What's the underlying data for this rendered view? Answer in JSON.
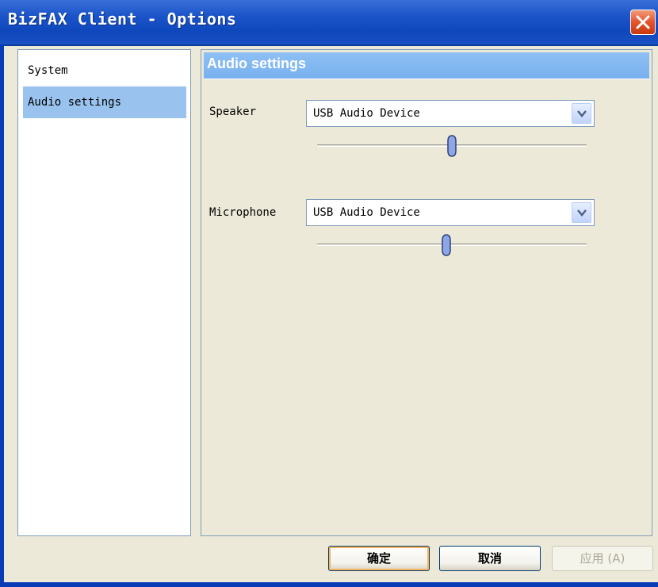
{
  "window": {
    "title": "BizFAX Client - Options"
  },
  "sidebar": {
    "items": [
      {
        "label": "System",
        "selected": false
      },
      {
        "label": "Audio settings",
        "selected": true
      }
    ]
  },
  "panel": {
    "header": "Audio settings",
    "speaker": {
      "label": "Speaker",
      "device": "USB Audio Device",
      "volume_fraction": 0.5
    },
    "microphone": {
      "label": "Microphone",
      "device": "USB Audio Device",
      "volume_fraction": 0.48
    }
  },
  "buttons": {
    "ok": "确定",
    "cancel": "取消",
    "apply": "应用 (A)"
  },
  "colors": {
    "titlebar": "#1c55c9",
    "selection": "#99c3ee",
    "panel_header": "#78b0ef"
  }
}
